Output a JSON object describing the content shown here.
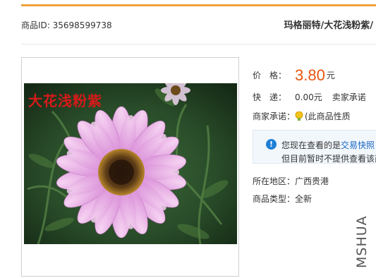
{
  "header": {
    "product_id": "商品ID: 35698599738",
    "title": "玛格丽特/大花浅粉紫/"
  },
  "gallery": {
    "caption": "大花浅粉紫"
  },
  "details": {
    "price_label": "价　格：",
    "price": "3.80",
    "price_unit": "元",
    "shipping_label": "快　递：",
    "shipping_value": "0.00元",
    "shipping_extra": "卖家承诺",
    "promise_label": "商家承诺：",
    "promise_text": "(此商品性质",
    "notice_prefix": "您现在查看的是",
    "notice_link": "交易快照",
    "notice_line2": "但目前暂时不提供查看该商",
    "region_label": "所在地区：",
    "region_value": "广西贵港",
    "type_label": "商品类型：",
    "type_value": "全新"
  },
  "watermark": "MSHUA",
  "colors": {
    "accent_bar": "#f0a33c",
    "price": "#e8540f",
    "link": "#1a66c1",
    "caption": "#d61a1a"
  },
  "icons": [
    "info-icon",
    "promise-badge-icon"
  ]
}
